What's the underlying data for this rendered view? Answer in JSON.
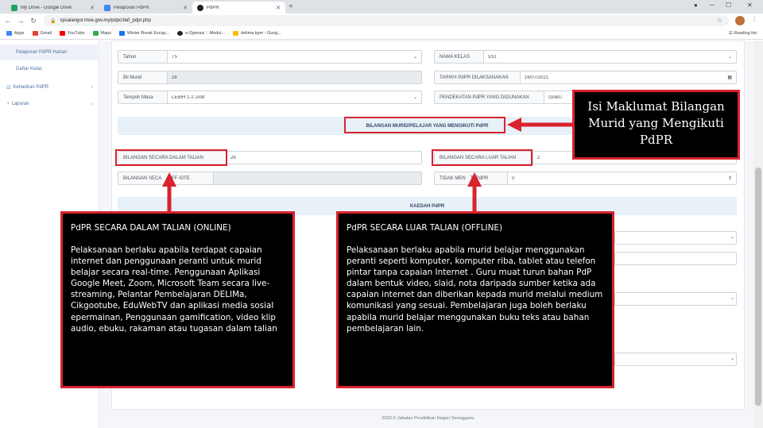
{
  "browser": {
    "tabs": [
      {
        "title": "My Drive - Google Drive",
        "color": "#1fa463"
      },
      {
        "title": "Pelaporan PdPR",
        "color": "#4285f4"
      },
      {
        "title": "PdPR",
        "color": "#202124"
      }
    ],
    "new_tab_symbol": "+",
    "url": "spsalangor.moe.gov.my/pdpc/daf_pdpr.php",
    "bookmarks": [
      "Apps",
      "Gmail",
      "YouTube",
      "Maps",
      "Winter Break Escap...",
      "e-Operasi :: Modul...",
      "delima kpm - Goog..."
    ],
    "reading_list": "Reading list"
  },
  "sidebar": {
    "items": [
      {
        "label": "Pelaporan PdPR Harian"
      },
      {
        "label": "Daftar Kelas"
      },
      {
        "label": "Kehadiran PdPR"
      },
      {
        "label": "Laporan"
      }
    ]
  },
  "form": {
    "tahun_label": "Tahun",
    "tahun_value": "T5",
    "nama_kelas_label": "NAMA KELAS",
    "nama_kelas_value": "5S1",
    "bil_murid_label": "Bil Murid",
    "bil_murid_value": "28",
    "tarikh_label": "TARIKH PdPR DILAKSANAKAN",
    "tarikh_value": "16/07/2021",
    "tempoh_label": "Tempoh Masa",
    "tempoh_value": "LEBIH 1-2 JAM",
    "pendekatan_label": "PENDEKATAN PdPR YANG DIGUNAKAN",
    "pendekatan_value": "GABU",
    "section_bilangan": "BILANGAN MURID/PELAJAR YANG MENGIKUTI PdPR",
    "dalam_label": "BILANGAN SECARA DALAM TALIAN",
    "dalam_value": "26",
    "luar_label": "BILANGAN SECARA LUAR TALIAN",
    "luar_value": "2",
    "offsite_label": "BILANGAN SECA",
    "offsite_label_tail": "OFF-SITE",
    "tidak_label": "TIDAK MEN",
    "tidak_label_tail": "TI PdPR",
    "tidak_value": "0",
    "section_kaedah": "KAEDAH PdPR"
  },
  "footer": "2020 © Jabatan Pendidikan Negeri Terengganu",
  "annotations": {
    "top_right": "Isi Maklumat Bilangan Murid yang Mengikuti PdPR",
    "online_title": "PdPR SECARA DALAM TALIAN (ONLINE)",
    "online_body": "Pelaksanaan berlaku apabila terdapat capaian internet dan penggunaan peranti untuk murid belajar secara real-time. Penggunaan Aplikasi Google Meet, Zoom, Microsoft Team secara live-streaming, Pelantar Pembelajaran DELIMa, Cikgootube, EduWebTV dan aplikasi media sosial epermainan, Penggunaan gamification, video klip audio, ebuku, rakaman atau tugasan dalam talian",
    "offline_title": "PdPR SECARA LUAR TALIAN (OFFLINE)",
    "offline_body": "Pelaksanaan berlaku apabila murid belajar menggunakan peranti seperti komputer, komputer riba, tablet atau telefon pintar tanpa capaian Internet . Guru muat turun bahan PdP dalam bentuk video, slaid, nota daripada sumber ketika ada capaian internet dan diberikan kepada murid melalui medium komunikasi yang sesuai. Pembelajaran juga boleh berlaku apabila murid belajar menggunakan buku teks atau bahan pembelajaran lain."
  },
  "colors": {
    "annotation_red": "#d9232e",
    "section_bg": "#e8f0f8",
    "link_blue": "#4a6fa5"
  }
}
